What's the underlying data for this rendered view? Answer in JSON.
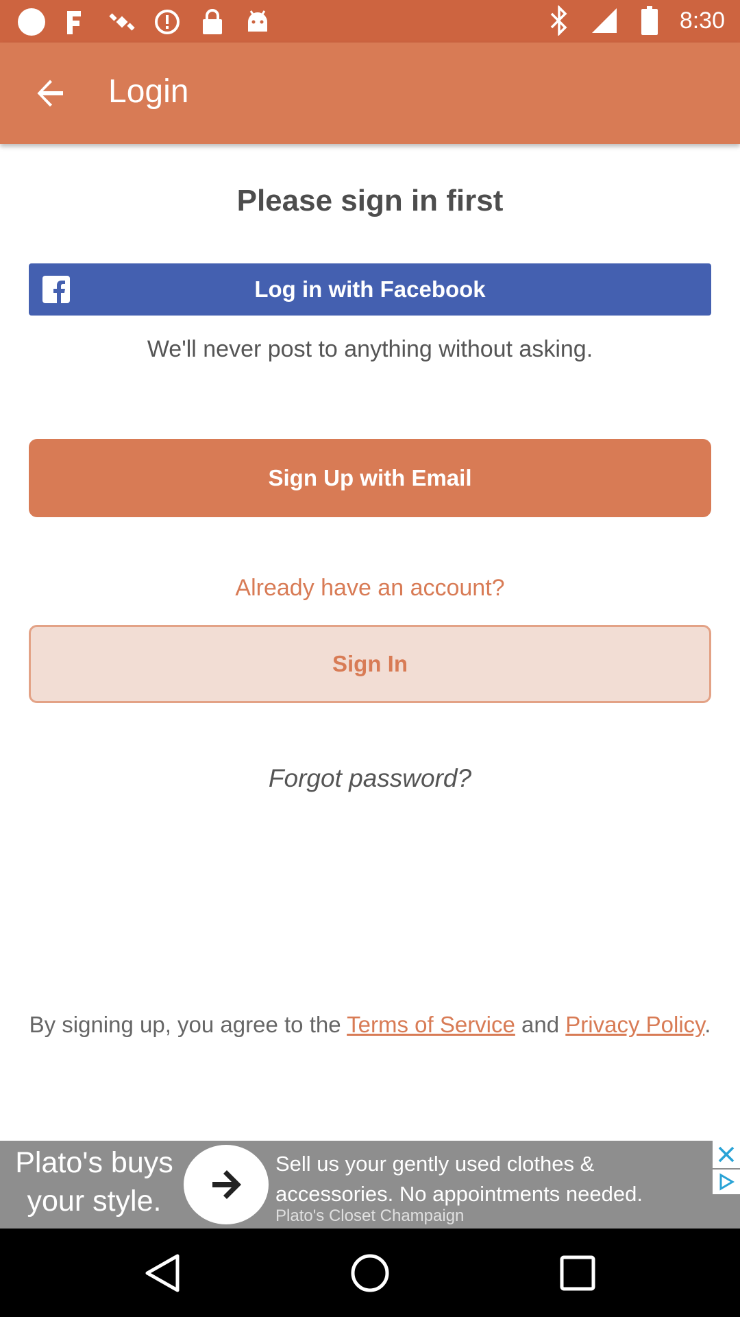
{
  "status_bar": {
    "time": "8:30",
    "icons": [
      "circle-icon",
      "fake-gps-icon",
      "satellite-icon",
      "alert-icon",
      "lock-icon",
      "android-icon",
      "bluetooth-icon",
      "signal-icon",
      "battery-icon"
    ]
  },
  "app_bar": {
    "title": "Login"
  },
  "main": {
    "heading": "Please sign in first",
    "facebook_button": "Log in with Facebook",
    "never_post_note": "We'll never post to anything without asking.",
    "email_button": "Sign Up with Email",
    "already_account": "Already have an account?",
    "signin_button": "Sign In",
    "forgot_password": "Forgot password?",
    "terms": {
      "prefix": "By signing up, you agree to the ",
      "tos": "Terms of Service",
      "mid": " and ",
      "privacy": "Privacy Policy",
      "suffix": "."
    }
  },
  "ad": {
    "headline": "Plato's buys your style.",
    "body": "Sell us your gently used clothes & accessories. No appointments needed.",
    "advertiser": "Plato's Closet Champaign"
  },
  "colors": {
    "status_bar": "#cd6440",
    "app_bar": "#d87b55",
    "facebook": "#4460b0",
    "accent": "#d87b55",
    "signin_bg": "#f2ddd4"
  }
}
